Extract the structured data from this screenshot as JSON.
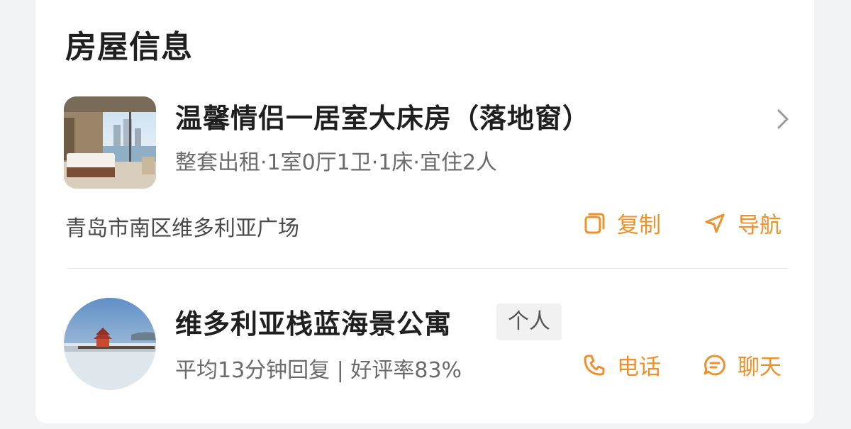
{
  "section": {
    "title": "房屋信息"
  },
  "room": {
    "name": "温馨情侣一居室大床房（落地窗）",
    "description": "整套出租·1室0厅1卫·1床·宜住2人",
    "thumbnail_icon": "room-photo"
  },
  "address": {
    "text": "青岛市南区维多利亚广场",
    "copy_label": "复制",
    "navigate_label": "导航"
  },
  "host": {
    "name": "维多利亚栈蓝海景公寓",
    "tag": "个人",
    "stats": "平均13分钟回复 | 好评率83%",
    "phone_label": "电话",
    "chat_label": "聊天",
    "avatar_icon": "host-avatar-photo"
  },
  "colors": {
    "accent": "#f0902a",
    "title_text": "#1f1f1f",
    "secondary_text": "#6b6b6b",
    "divider": "#e8e8e8"
  }
}
